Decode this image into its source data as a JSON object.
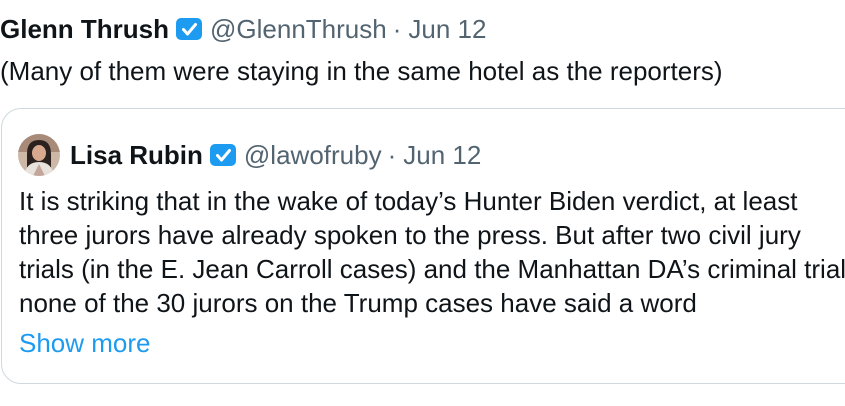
{
  "tweet": {
    "author_name": "Glenn Thrush",
    "author_handle": "@GlennThrush",
    "separator": "·",
    "date": "Jun 12",
    "text": "(Many of them were staying in the same hotel as the reporters)",
    "verified_icon": "verified-badge-icon"
  },
  "quote": {
    "author_name": "Lisa Rubin",
    "author_handle": "@lawofruby",
    "separator": "·",
    "date": "Jun 12",
    "lines": [
      "It is striking that in the wake of today’s Hunter Biden verdict, at least",
      "three jurors have already spoken to the press. But after two civil jury",
      "trials (in the E. Jean Carroll cases) and the Manhattan DA’s criminal trial,",
      "none of the 30 jurors on the Trump cases have said a word"
    ],
    "show_more": "Show more",
    "verified_icon": "verified-badge-icon"
  },
  "colors": {
    "text": "#0f1419",
    "secondary": "#536471",
    "link": "#1d9bf0",
    "verified": "#1d9bf0",
    "border": "#cfd9de"
  }
}
